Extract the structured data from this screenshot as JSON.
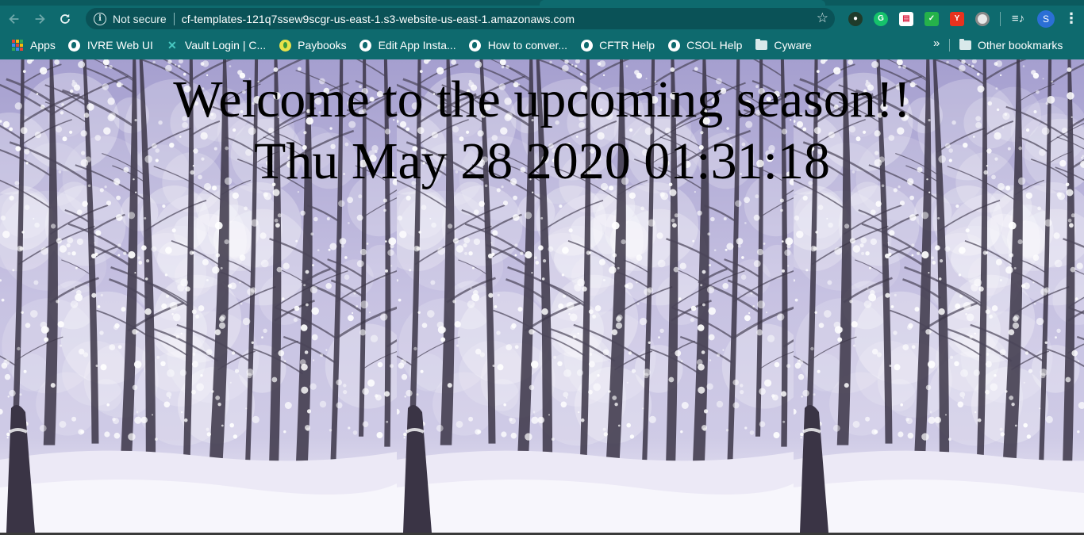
{
  "browser": {
    "omnibox": {
      "security_label": "Not secure",
      "url": "cf-templates-121q7ssew9scgr-us-east-1.s3-website-us-east-1.amazonaws.com"
    },
    "profile_initial": "S",
    "bookmarks": [
      {
        "label": "Apps",
        "icon": "apps-grid-icon"
      },
      {
        "label": "IVRE Web UI",
        "icon": "globe-icon"
      },
      {
        "label": "Vault Login | C...",
        "icon": "vault-icon"
      },
      {
        "label": "Paybooks",
        "icon": "paybooks-icon"
      },
      {
        "label": "Edit App Insta...",
        "icon": "globe-icon"
      },
      {
        "label": "How to conver...",
        "icon": "globe-icon"
      },
      {
        "label": "CFTR Help",
        "icon": "globe-icon"
      },
      {
        "label": "CSOL Help",
        "icon": "globe-icon"
      },
      {
        "label": "Cyware",
        "icon": "folder-icon"
      }
    ],
    "overflow_label": "»",
    "other_bookmarks": "Other bookmarks"
  },
  "page": {
    "headline": "Welcome to the upcoming season!!",
    "datetime": "Thu May 28 2020 01:31:18"
  }
}
